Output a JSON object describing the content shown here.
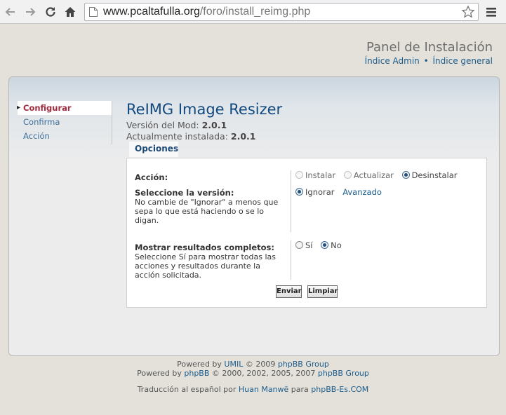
{
  "browser": {
    "url_host": "www.pcaltafulla.org",
    "url_path": "/foro/install_reimg.php"
  },
  "header": {
    "title": "Panel de Instalación",
    "link_admin": "Índice Admin",
    "separator": "•",
    "link_general": "Índice general"
  },
  "sidebar": {
    "items": [
      {
        "label": "Configurar",
        "active": true
      },
      {
        "label": "Confirma",
        "active": false
      },
      {
        "label": "Acción",
        "active": false
      }
    ]
  },
  "mod": {
    "title": "ReIMG Image Resizer",
    "version_label": "Versión del Mod:",
    "version": "2.0.1",
    "installed_label": "Actualmente instalada:",
    "installed": "2.0.1"
  },
  "tab": {
    "label": "Opciones"
  },
  "options": {
    "action": {
      "label": "Acción:",
      "choices": [
        "Instalar",
        "Actualizar",
        "Desinstalar"
      ],
      "selected": "Desinstalar"
    },
    "version": {
      "label": "Seleccione la versión:",
      "help": "No cambie de \"Ignorar\" a menos que sepa lo que está haciendo o se lo digan.",
      "choice": "Ignorar",
      "selected": "Ignorar",
      "advanced_link": "Avanzado"
    },
    "full_results": {
      "label": "Mostrar resultados completos:",
      "help": "Seleccione Sí para mostrar todas las acciones y resultados durante la acción solicitada.",
      "choices": [
        "Sí",
        "No"
      ],
      "selected": "No"
    }
  },
  "buttons": {
    "submit": "Enviar",
    "reset": "Limpiar"
  },
  "footer": {
    "line1_prefix": "Powered by ",
    "line1_umil": "UMIL",
    "line1_mid": " © 2009 ",
    "line1_group": "phpBB Group",
    "line2_prefix": "Powered by ",
    "line2_phpbb": "phpBB",
    "line2_mid": " © 2000, 2002, 2005, 2007 ",
    "line2_group": "phpBB Group",
    "line3_prefix": "Traducción al español por ",
    "line3_author": "Huan Manwë",
    "line3_mid": " para ",
    "line3_site": "phpBB-Es.COM"
  }
}
